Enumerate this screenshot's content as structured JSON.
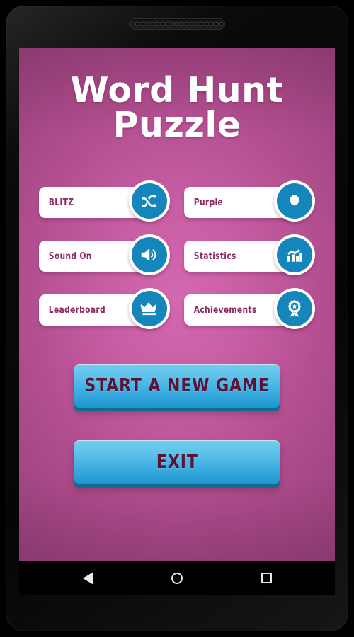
{
  "app": {
    "title_line_1": "Word Hunt",
    "title_line_2": "Puzzle",
    "background_color": "#c75da3",
    "accent_color": "#1486bb",
    "label_color": "#8e2a66",
    "action_button_color": "#5fc2ea"
  },
  "menu": {
    "items": [
      {
        "label": "BLITZ",
        "icon": "shuffle-icon"
      },
      {
        "label": "Purple",
        "icon": "theme-picker-icon"
      },
      {
        "label": "Sound On",
        "icon": "speaker-on-icon"
      },
      {
        "label": "Statistics",
        "icon": "bar-chart-icon"
      },
      {
        "label": "Leaderboard",
        "icon": "crown-icon"
      },
      {
        "label": "Achievements",
        "icon": "award-ribbon-icon"
      }
    ]
  },
  "actions": {
    "start_label": "START A NEW GAME",
    "exit_label": "EXIT"
  },
  "navbar": {
    "back": "back-icon",
    "home": "home-icon",
    "recents": "recents-icon"
  }
}
